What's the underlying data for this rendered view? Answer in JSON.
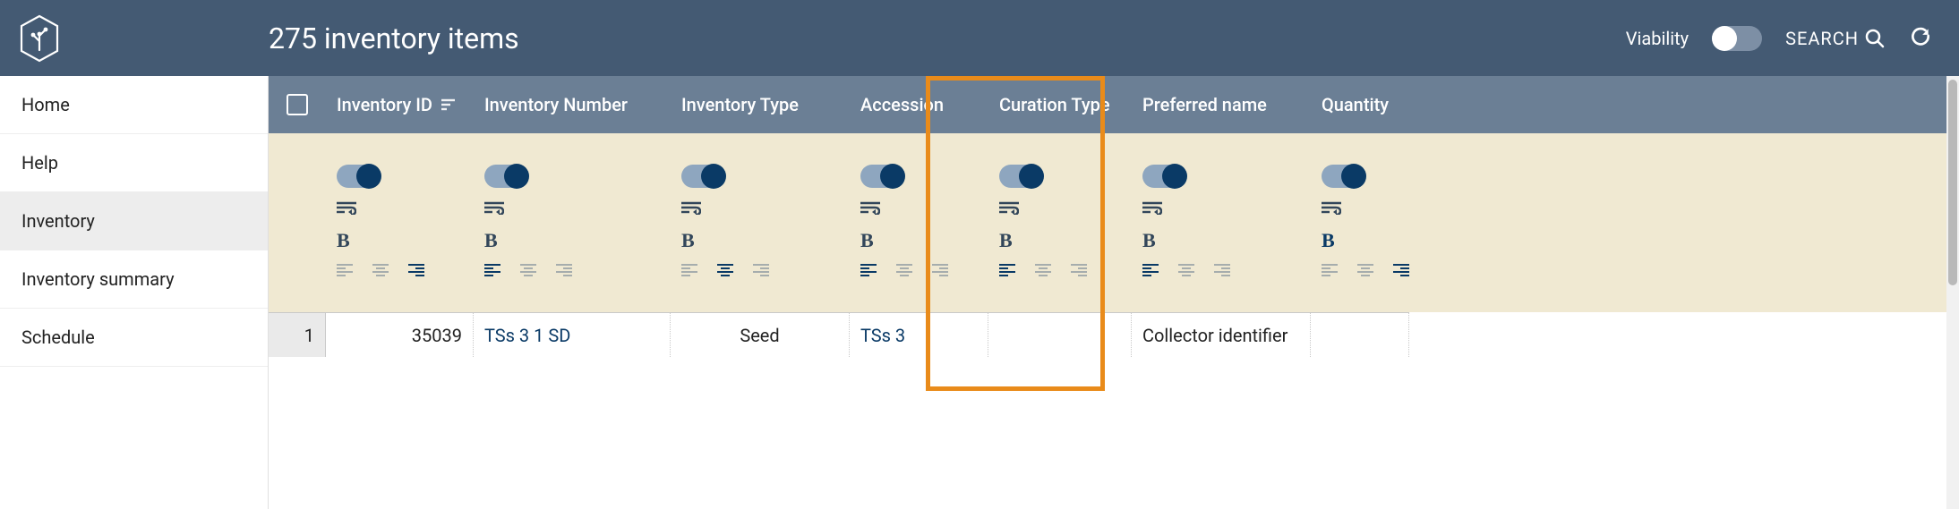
{
  "header": {
    "title": "275 inventory items",
    "viability_label": "Viability",
    "search_label": "SEARCH"
  },
  "sidebar": {
    "items": [
      {
        "label": "Home",
        "selected": false
      },
      {
        "label": "Help",
        "selected": false
      },
      {
        "label": "Inventory",
        "selected": true
      },
      {
        "label": "Inventory summary",
        "selected": false
      },
      {
        "label": "Schedule",
        "selected": false
      }
    ]
  },
  "columns": [
    {
      "key": "id",
      "label": "Inventory ID",
      "sortable": true,
      "bold_active": false,
      "align_active": 2
    },
    {
      "key": "num",
      "label": "Inventory Number",
      "sortable": false,
      "bold_active": false,
      "align_active": 0
    },
    {
      "key": "type",
      "label": "Inventory Type",
      "sortable": false,
      "bold_active": false,
      "align_active": 1
    },
    {
      "key": "acc",
      "label": "Accession",
      "sortable": false,
      "bold_active": false,
      "align_active": 0
    },
    {
      "key": "cur",
      "label": "Curation Type",
      "sortable": false,
      "bold_active": false,
      "align_active": 0
    },
    {
      "key": "pref",
      "label": "Preferred name",
      "sortable": false,
      "bold_active": false,
      "align_active": 0
    },
    {
      "key": "qty",
      "label": "Quantity",
      "sortable": false,
      "bold_active": true,
      "align_active": 2
    }
  ],
  "rows": [
    {
      "n": "1",
      "id": "35039",
      "num": "TSs 3 1 SD",
      "type": "Seed",
      "acc": "TSs 3",
      "cur": "",
      "pref": "Collector identifier",
      "qty": ""
    }
  ],
  "highlighted_column": "type"
}
